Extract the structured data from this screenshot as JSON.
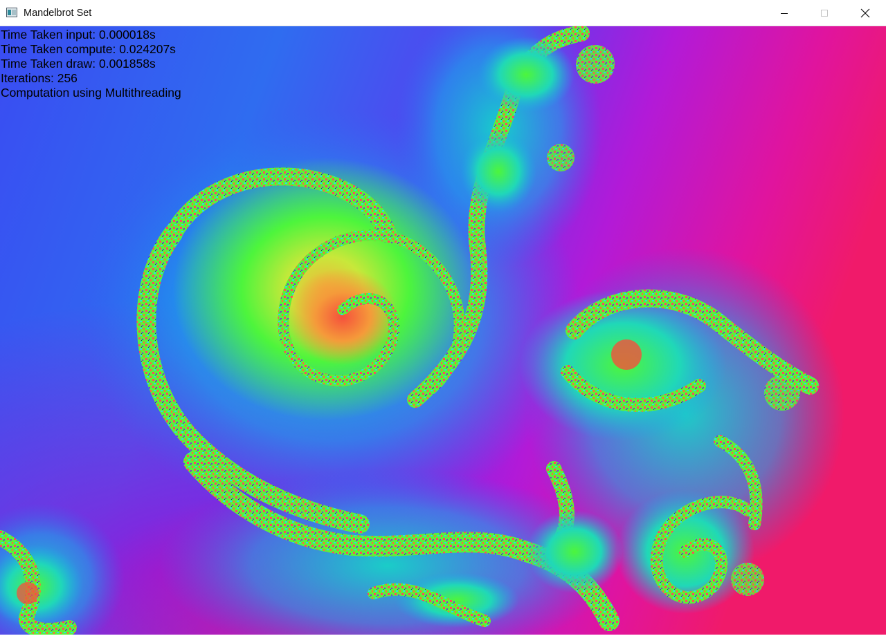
{
  "window": {
    "title": "Mandelbrot Set",
    "icon": "app-window-icon",
    "controls": {
      "minimize_icon": "minimize-icon",
      "maximize_icon": "maximize-icon",
      "close_icon": "close-icon"
    }
  },
  "overlay": {
    "lines": [
      "Time Taken input: 0.000018s",
      "Time Taken compute: 0.024207s",
      "Time Taken draw: 0.001858s",
      "Iterations: 256",
      "Computation using Multithreading"
    ],
    "text_color": "#000000"
  },
  "fractal": {
    "palette": [
      "#7a1fe0",
      "#2f5cf0",
      "#1fa6e8",
      "#12d8c6",
      "#4bf53a",
      "#f5c23a",
      "#f5503c",
      "#e01e8a"
    ],
    "background_left": "#2d6cf0",
    "background_right": "#ee1c72"
  }
}
